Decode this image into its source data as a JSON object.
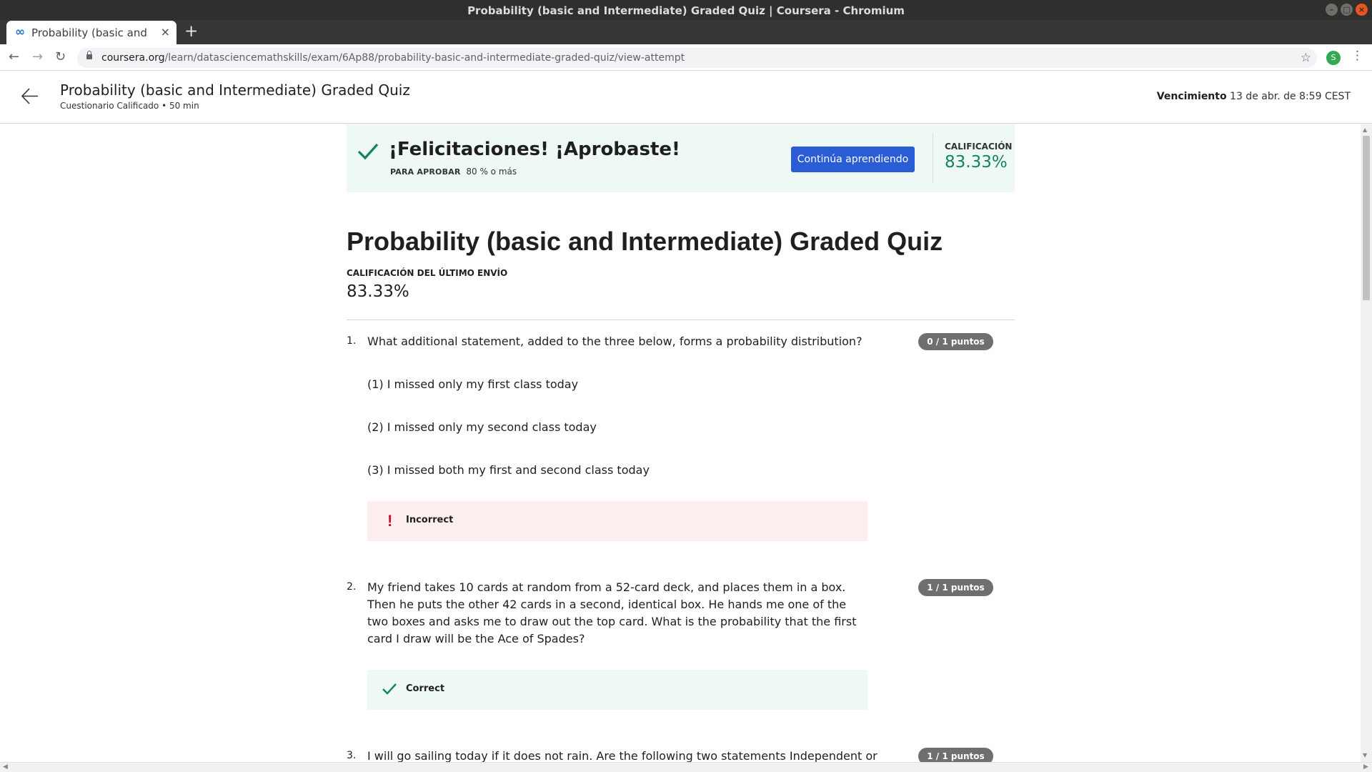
{
  "window": {
    "title": "Probability (basic and Intermediate) Graded Quiz | Coursera - Chromium"
  },
  "tab": {
    "title": "Probability (basic and Intermediate) Graded Quiz | Coursera",
    "close": "×",
    "new_tab": "+"
  },
  "omnibox": {
    "host": "coursera.org",
    "path": "/learn/datasciencemathskills/exam/6Ap88/probability-basic-and-intermediate-graded-quiz/view-attempt"
  },
  "profile": {
    "initial": "S"
  },
  "icons": {
    "back": "←",
    "forward": "→",
    "reload": "↻",
    "star": "☆",
    "menu": "⋮",
    "win_min": "–",
    "win_max": "□",
    "win_close": "×",
    "favicon": "∞",
    "scroll_up": "▲",
    "scroll_down": "▼",
    "scroll_left": "◀",
    "scroll_right": "▶"
  },
  "header": {
    "title": "Probability (basic and Intermediate) Graded Quiz",
    "subtitle": "Cuestionario Calificado • 50 min",
    "due_label": "Vencimiento",
    "due_value": "13 de abr. de 8:59 CEST"
  },
  "banner": {
    "title": "¡Felicitaciones! ¡Aprobaste!",
    "pass_label": "PARA APROBAR",
    "pass_value": "80 % o más",
    "continue": "Continúa aprendiendo",
    "grade_label": "CALIFICACIÓN",
    "grade_value": "83.33%"
  },
  "quiz": {
    "title": "Probability (basic and Intermediate) Graded Quiz",
    "last_label": "CALIFICACIÓN DEL ÚLTIMO ENVÍO",
    "last_value": "83.33%"
  },
  "questions": [
    {
      "number": "1.",
      "text": "What additional statement, added to the three below, forms a probability distribution?",
      "points": "0 / 1 puntos",
      "lines": [
        "(1) I missed only my first class today",
        "(2) I missed only my second class today",
        "(3) I missed both my first and second class today"
      ],
      "feedback": "Incorrect"
    },
    {
      "number": "2.",
      "text": "My friend takes 10 cards at random from a 52-card deck, and places them in a box. Then he puts the other 42 cards in a second, identical box. He hands me one of the two boxes and asks me to draw out the top card. What is the probability that the first card I draw will be the Ace of Spades?",
      "points": "1 / 1 puntos",
      "feedback": "Correct"
    },
    {
      "number": "3.",
      "text": "I will go sailing today if it does not rain. Are the following two statements Independent or",
      "points": "1 / 1 puntos"
    }
  ],
  "colors": {
    "brand_blue": "#2a5cd6",
    "pass_green": "#128560",
    "error_red": "#c8102e"
  }
}
